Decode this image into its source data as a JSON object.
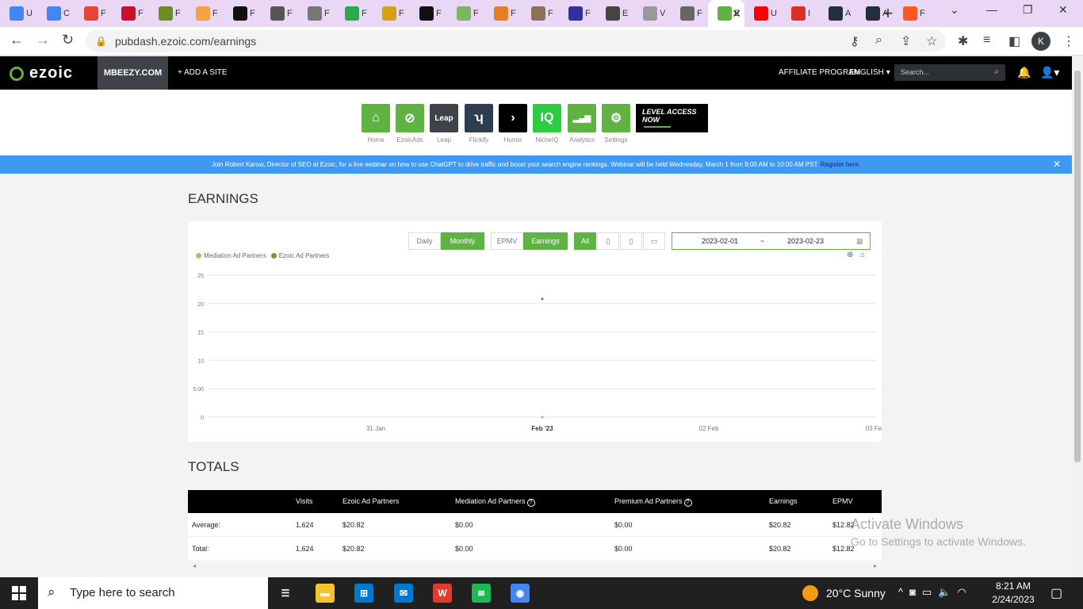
{
  "browser": {
    "tabs": [
      {
        "title": "U",
        "icon": "google-docs-icon",
        "color": "#4285f4"
      },
      {
        "title": "C",
        "icon": "google-docs-icon",
        "color": "#4285f4"
      },
      {
        "title": "F",
        "icon": "google-icon",
        "color": "#ea4335"
      },
      {
        "title": "F",
        "icon": "flag-icon",
        "color": "#c8102e"
      },
      {
        "title": "F",
        "icon": "site-icon",
        "color": "#6b8e23"
      },
      {
        "title": "F",
        "icon": "pencil-icon",
        "color": "#f4a340"
      },
      {
        "title": "F",
        "icon": "site-icon",
        "color": "#111111"
      },
      {
        "title": "F",
        "icon": "tool-icon",
        "color": "#555555"
      },
      {
        "title": "F",
        "icon": "site-icon",
        "color": "#777777"
      },
      {
        "title": "F",
        "icon": "site-icon",
        "color": "#2ea84f"
      },
      {
        "title": "F",
        "icon": "site-icon",
        "color": "#d4a017"
      },
      {
        "title": "F",
        "icon": "site-icon",
        "color": "#111111"
      },
      {
        "title": "F",
        "icon": "site-icon",
        "color": "#7bb661"
      },
      {
        "title": "F",
        "icon": "site-icon",
        "color": "#e67e22"
      },
      {
        "title": "F",
        "icon": "site-icon",
        "color": "#8b7355"
      },
      {
        "title": "F",
        "icon": "site-icon",
        "color": "#2f2fa2"
      },
      {
        "title": "E",
        "icon": "site-icon",
        "color": "#444444"
      },
      {
        "title": "V",
        "icon": "site-icon",
        "color": "#999999"
      },
      {
        "title": "F",
        "icon": "site-icon",
        "color": "#666666"
      },
      {
        "title": "E",
        "icon": "ezoic-icon",
        "color": "#5fb342",
        "active": true
      },
      {
        "title": "U",
        "icon": "youtube-icon",
        "color": "#ff0000"
      },
      {
        "title": "I",
        "icon": "gmail-icon",
        "color": "#d93025"
      },
      {
        "title": "A",
        "icon": "amazon-icon",
        "color": "#232f3e"
      },
      {
        "title": "A",
        "icon": "amazon-icon",
        "color": "#232f3e"
      },
      {
        "title": "F",
        "icon": "site-icon",
        "color": "#ff5722"
      }
    ],
    "url": "pubdash.ezoic.com/earnings",
    "profile_initial": "K"
  },
  "ezoic": {
    "logo": "ezoic",
    "site": "MBEEZY.COM",
    "add_site": "+ ADD A SITE",
    "affiliate": "AFFILIATE PROGRAM",
    "language": "ENGLISH",
    "search_placeholder": "Search...",
    "apps": [
      {
        "label": "Home",
        "color": "#5fb342",
        "icon": "home-icon",
        "glyph": "⌂"
      },
      {
        "label": "EzoicAds",
        "color": "#5fb342",
        "icon": "ezoic-ads-icon",
        "glyph": "⊘"
      },
      {
        "label": "Leap",
        "color": "#3f4349",
        "icon": "leap-icon",
        "glyph": "Leap"
      },
      {
        "label": "Flickify",
        "color": "#2d3e50",
        "icon": "flickify-icon",
        "glyph": "ʮ"
      },
      {
        "label": "Humix",
        "color": "#000000",
        "icon": "humix-icon",
        "glyph": "›"
      },
      {
        "label": "NicheIQ",
        "color": "#2ecc40",
        "icon": "nicheiq-icon",
        "glyph": "IQ"
      },
      {
        "label": "Analytics",
        "color": "#5fb342",
        "icon": "analytics-icon",
        "glyph": "▂▄▆"
      },
      {
        "label": "Settings",
        "color": "#5fb342",
        "icon": "gear-icon",
        "glyph": "⚙"
      }
    ],
    "promo_text": "LEVEL ACCESS NOW",
    "banner_text": "Join Robert Karow, Director of SEO at Ezoic, for a live webinar on how to use ChatGPT to drive traffic and boost your search engine rankings. Webinar will be held Wednesday, March 1 from 9:00 AM to 10:00 AM PST.",
    "banner_link": "Register here."
  },
  "page": {
    "title": "EARNINGS",
    "controls": {
      "daily": "Daily",
      "monthly": "Monthly",
      "epmv": "EPMV",
      "earnings": "Earnings",
      "all": "All",
      "date_start": "2023-02-01",
      "date_sep": "~",
      "date_end": "2023-02-23"
    },
    "totals_title": "TOTALS"
  },
  "chart_data": {
    "type": "line",
    "series": [
      {
        "name": "Mediation Ad Partners",
        "color": "#8fcf6f",
        "points": [
          [
            "Feb '23",
            0
          ]
        ]
      },
      {
        "name": "Ezoic Ad Partners",
        "color": "#5fa330",
        "points": [
          [
            "Feb '23",
            20.82
          ]
        ]
      }
    ],
    "x_ticks": [
      "31 Jan",
      "Feb '23",
      "02 Feb",
      "03 Fe"
    ],
    "y_ticks": [
      "0",
      "5.00",
      "10",
      "15",
      "20",
      "25"
    ],
    "ylim": [
      0,
      25
    ],
    "grid": true,
    "legend": "top-left"
  },
  "totals_table": {
    "columns": [
      "",
      "Visits",
      "Ezoic Ad Partners",
      "Mediation Ad Partners",
      "Premium Ad Partners",
      "Earnings",
      "EPMV"
    ],
    "rows": [
      [
        "Average:",
        "1,624",
        "$20.82",
        "$0.00",
        "$0.00",
        "$20.82",
        "$12.82"
      ],
      [
        "Total:",
        "1,624",
        "$20.82",
        "$0.00",
        "$0.00",
        "$20.82",
        "$12.82"
      ]
    ]
  },
  "watermark": {
    "line1": "Activate Windows",
    "line2": "Go to Settings to activate Windows."
  },
  "taskbar": {
    "search_placeholder": "Type here to search",
    "weather": "20°C  Sunny",
    "time": "8:21 AM",
    "date": "2/24/2023",
    "apps": [
      {
        "name": "task-view-icon",
        "color": "#202020"
      },
      {
        "name": "file-explorer-icon",
        "color": "#f4c430"
      },
      {
        "name": "microsoft-store-icon",
        "color": "#0078d4"
      },
      {
        "name": "mail-icon",
        "color": "#0078d4"
      },
      {
        "name": "wps-office-icon",
        "color": "#e23a2e"
      },
      {
        "name": "spotify-icon",
        "color": "#1db954"
      },
      {
        "name": "chrome-icon",
        "color": "#4285f4"
      }
    ]
  }
}
